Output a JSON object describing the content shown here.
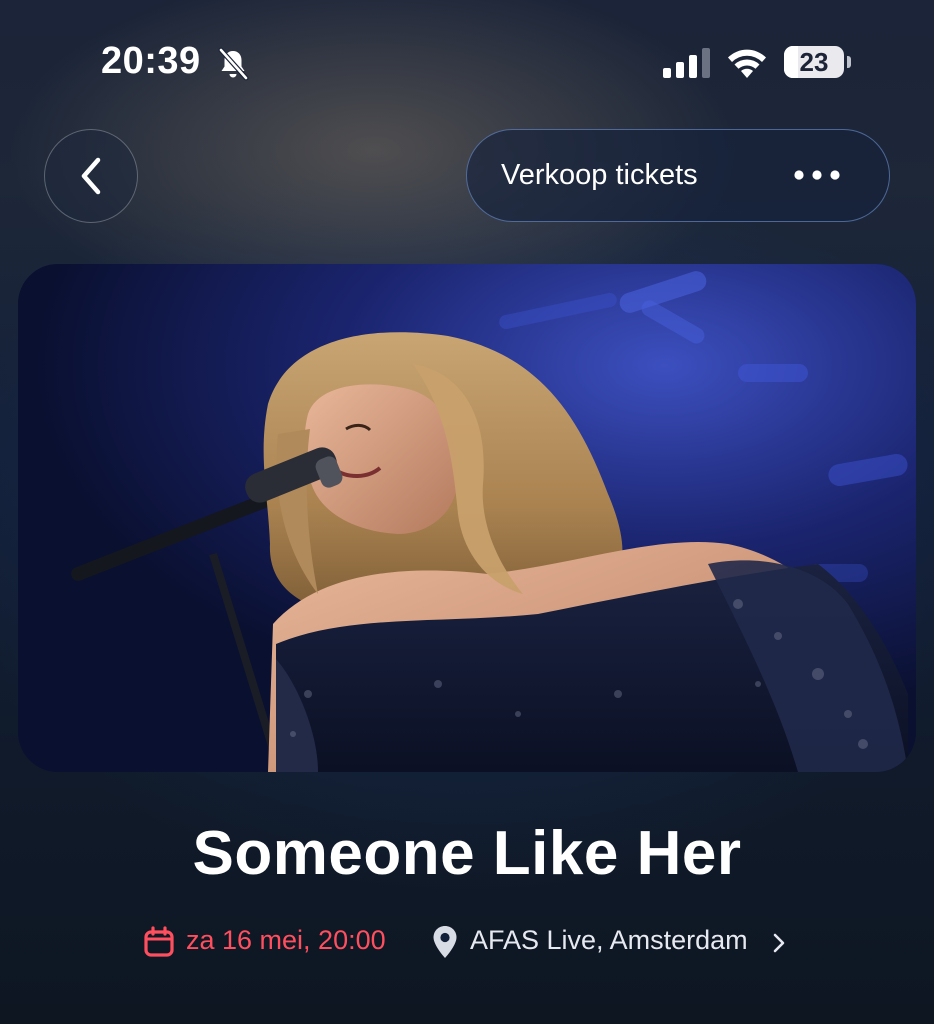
{
  "status_bar": {
    "time": "20:39",
    "battery": "23",
    "icons": [
      "bell-slash-icon",
      "cellular-signal-icon",
      "wifi-icon",
      "battery-icon"
    ]
  },
  "header": {
    "back_icon": "chevron-left-icon",
    "sell_label": "Verkoop tickets",
    "more_icon": "ellipsis-icon"
  },
  "hero": {
    "image_alt": ""
  },
  "event": {
    "title": "Someone Like Her",
    "date": "za 16 mei, 20:00",
    "venue": "AFAS Live, Amsterdam",
    "date_icon": "calendar-icon",
    "venue_icon": "location-pin-icon",
    "venue_chevron": "chevron-right-icon"
  },
  "colors": {
    "accent_date": "#ff4f5e",
    "pill_border": "#7aa0e6",
    "background": "#13203a"
  }
}
